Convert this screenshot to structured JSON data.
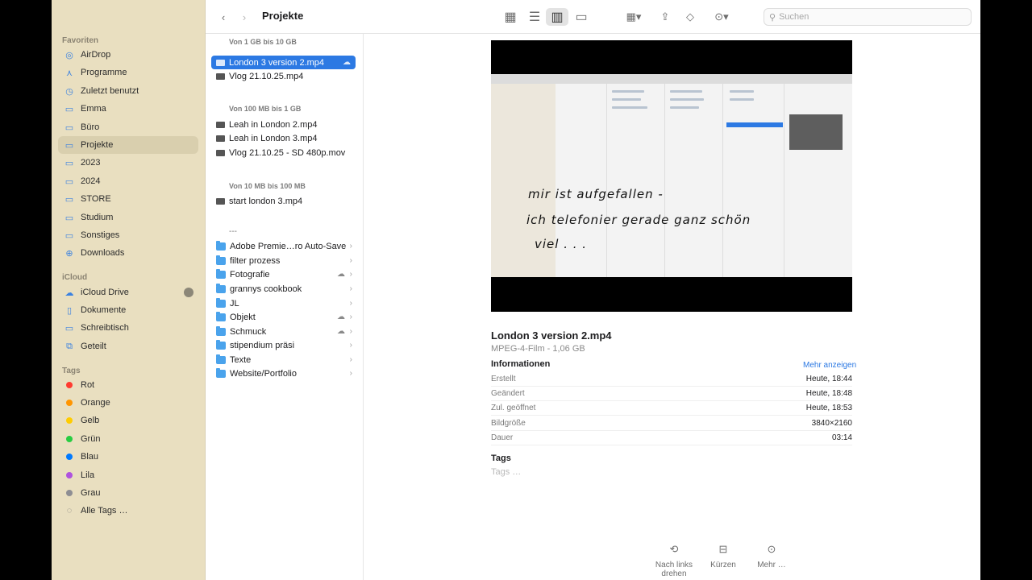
{
  "window": {
    "title": "Projekte"
  },
  "toolbar": {
    "title": "Projekte",
    "search_placeholder": "Suchen"
  },
  "sidebar": {
    "sections": {
      "favorites": "Favoriten",
      "icloud": "iCloud",
      "tags": "Tags"
    },
    "favorites": [
      {
        "label": "AirDrop",
        "icon": "airdrop-icon"
      },
      {
        "label": "Programme",
        "icon": "apps-icon"
      },
      {
        "label": "Zuletzt benutzt",
        "icon": "clock-icon"
      },
      {
        "label": "Emma",
        "icon": "folder-icon"
      },
      {
        "label": "Büro",
        "icon": "folder-icon"
      },
      {
        "label": "Projekte",
        "icon": "folder-icon"
      },
      {
        "label": "2023",
        "icon": "folder-icon"
      },
      {
        "label": "2024",
        "icon": "folder-icon"
      },
      {
        "label": "STORE",
        "icon": "folder-icon"
      },
      {
        "label": "Studium",
        "icon": "folder-icon"
      },
      {
        "label": "Sonstiges",
        "icon": "folder-icon"
      },
      {
        "label": "Downloads",
        "icon": "download-icon"
      }
    ],
    "icloud": [
      {
        "label": "iCloud Drive",
        "icon": "cloud-icon"
      },
      {
        "label": "Dokumente",
        "icon": "doc-icon"
      },
      {
        "label": "Schreibtisch",
        "icon": "desktop-icon"
      },
      {
        "label": "Geteilt",
        "icon": "shared-icon"
      }
    ],
    "tags": [
      {
        "label": "Rot",
        "color": "#ff3b30"
      },
      {
        "label": "Orange",
        "color": "#ff9500"
      },
      {
        "label": "Gelb",
        "color": "#ffcc00"
      },
      {
        "label": "Grün",
        "color": "#28cd41"
      },
      {
        "label": "Blau",
        "color": "#007aff"
      },
      {
        "label": "Lila",
        "color": "#af52de"
      },
      {
        "label": "Grau",
        "color": "#8e8e93"
      },
      {
        "label": "Alle Tags …",
        "color": ""
      }
    ]
  },
  "list": {
    "groups": [
      "Von 1 GB bis 10 GB",
      "Von 100 MB bis 1 GB",
      "Von 10 MB bis 100 MB"
    ],
    "files_1gb": [
      "London 3 version 2.mp4",
      "Vlog 21.10.25.mp4"
    ],
    "files_100mb": [
      "Leah in London 2.mp4",
      "Leah in London 3.mp4",
      "Vlog 21.10.25 - SD 480p.mov"
    ],
    "files_10mb": [
      "start london 3.mp4"
    ],
    "separator": "---",
    "folders": [
      "Adobe Premie…ro Auto-Save",
      "filter prozess",
      "Fotografie",
      "grannys cookbook",
      "JL",
      "Objekt",
      "Schmuck",
      "stipendium präsi",
      "Texte",
      "Website/Portfolio"
    ]
  },
  "preview": {
    "name": "London 3 version 2.mp4",
    "subtitle": "MPEG-4-Film - 1,06 GB",
    "handwriting": [
      "mir ist aufgefallen -",
      "ich telefonier gerade ganz schön",
      "viel . . ."
    ],
    "info_heading": "Informationen",
    "more_label": "Mehr anzeigen",
    "rows": [
      {
        "key": "Erstellt",
        "value": "Heute, 18:44"
      },
      {
        "key": "Geändert",
        "value": "Heute, 18:48"
      },
      {
        "key": "Zul. geöffnet",
        "value": "Heute, 18:53"
      },
      {
        "key": "Bildgröße",
        "value": "3840×2160"
      },
      {
        "key": "Dauer",
        "value": "03:14"
      }
    ],
    "tags_heading": "Tags",
    "tags_placeholder": "Tags …",
    "actions": [
      "Nach links drehen",
      "Kürzen",
      "Mehr …"
    ]
  }
}
